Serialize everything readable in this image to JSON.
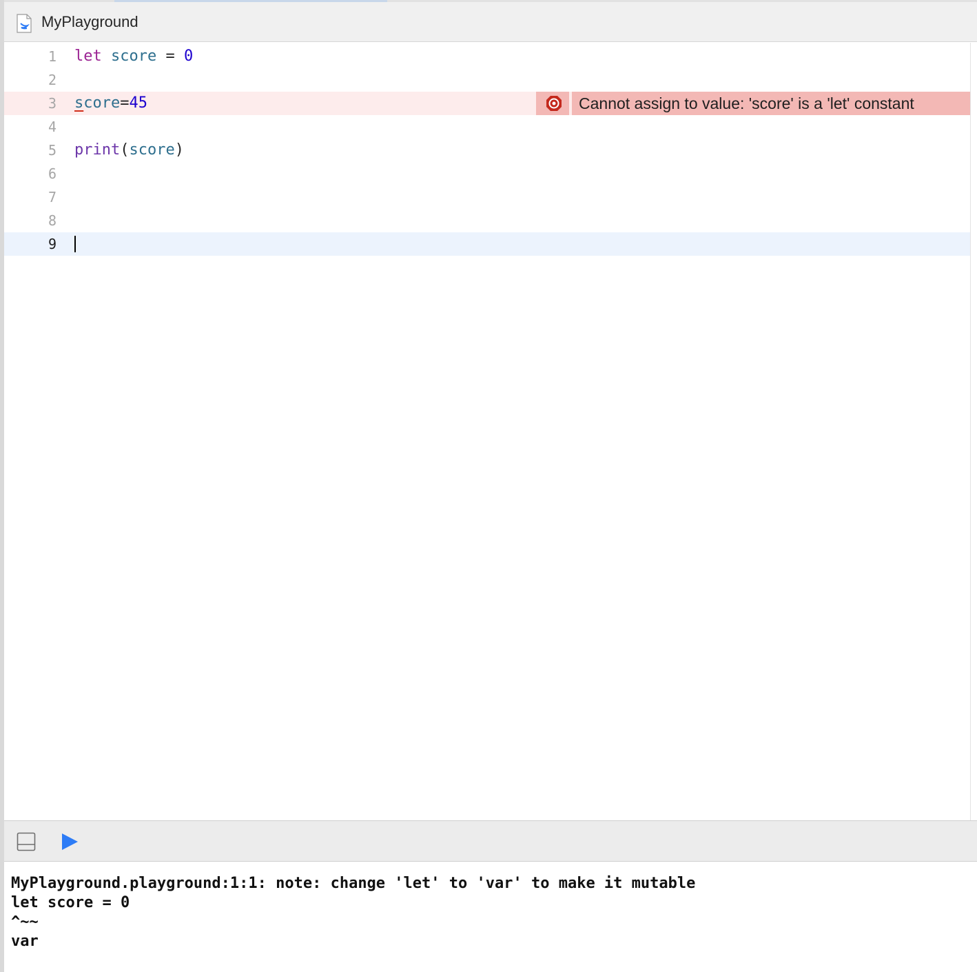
{
  "header": {
    "title": "MyPlayground",
    "icon": "swift-file-icon"
  },
  "editor": {
    "lines": [
      {
        "num": "1",
        "tokens": [
          "let",
          "score",
          "=",
          "0"
        ]
      },
      {
        "num": "2"
      },
      {
        "num": "3",
        "tokens": [
          "s",
          "core",
          "=",
          "45"
        ],
        "state": "error"
      },
      {
        "num": "4"
      },
      {
        "num": "5",
        "tokens": [
          "print",
          "(",
          "score",
          ")"
        ]
      },
      {
        "num": "6"
      },
      {
        "num": "7"
      },
      {
        "num": "8"
      },
      {
        "num": "9",
        "state": "current"
      }
    ],
    "error_message": "Cannot assign to value: 'score' is a 'let' constant"
  },
  "debug_bar": {
    "toggle_icon": "hide-debug-area-icon",
    "run_icon": "play-icon"
  },
  "console": {
    "lines": [
      "MyPlayground.playground:1:1: note: change 'let' to 'var' to make it mutable",
      "let score = 0",
      "^~~",
      "var"
    ]
  },
  "colors": {
    "keyword": "#9b2393",
    "identifier": "#2e6f8e",
    "number": "#1c00cf",
    "function": "#6c36a9",
    "error_bg": "#f3b8b5",
    "error_line_bg": "#fdecec",
    "current_line_bg": "#ecf3fd",
    "run_button": "#2d7cf6"
  }
}
